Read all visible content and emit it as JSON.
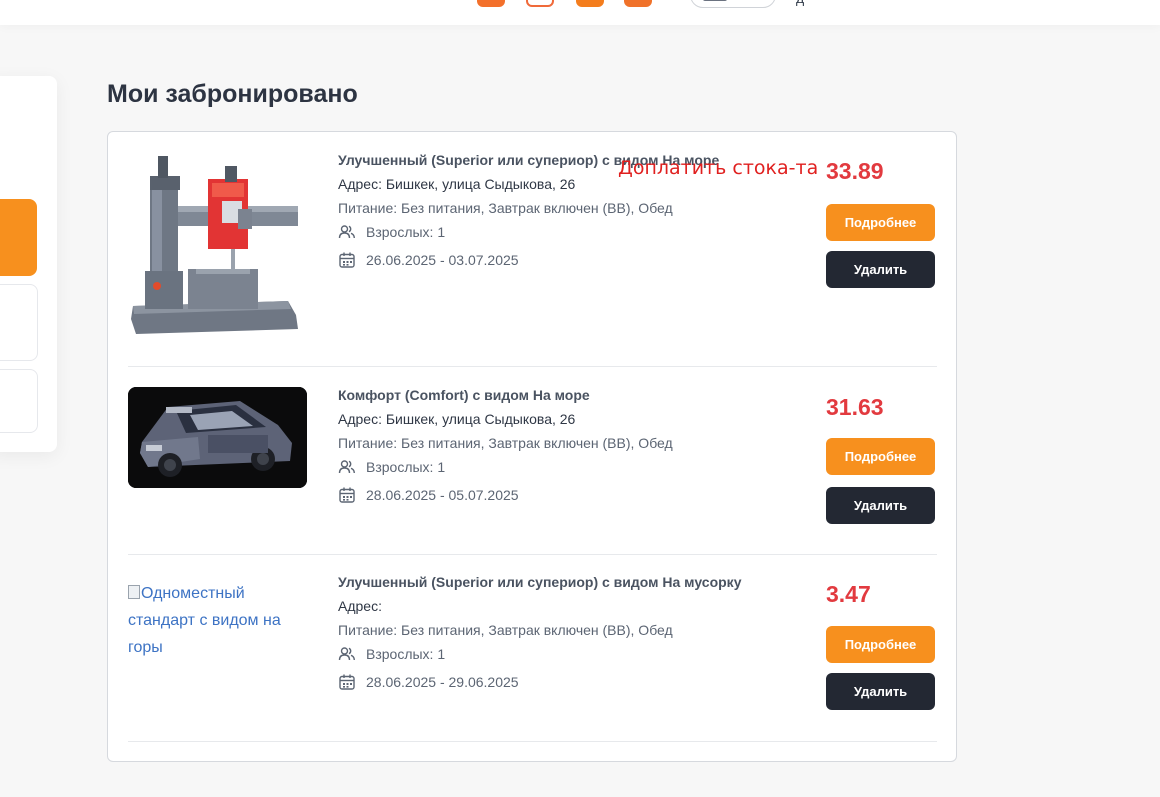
{
  "page_title": "Мои забронировано",
  "notice": "Доплатить стока-та",
  "topbar": {
    "trail_text": "д"
  },
  "colors": {
    "accent": "#f7901e",
    "dark_button": "#232833",
    "price": "#e23a3f",
    "notice": "#e0201f"
  },
  "bookings": [
    {
      "room_name": "Улучшенный (Superior или супериор) с видом На море",
      "address": "Адрес: Бишкек, улица Сыдыкова, 26",
      "meal": "Питание: Без питания, Завтрак включен (BB), Обед",
      "guests": "Взрослых: 1",
      "dates": "26.06.2025 - 03.07.2025",
      "price": "33.89",
      "more_label": "Подробнее",
      "delete_label": "Удалить",
      "image": "radial-drill-machine"
    },
    {
      "room_name": "Комфорт (Comfort) с видом На море",
      "address": "Адрес: Бишкек, улица Сыдыкова, 26",
      "meal": "Питание: Без питания, Завтрак включен (BB), Обед",
      "guests": "Взрослых: 1",
      "dates": "28.06.2025 - 05.07.2025",
      "price": "31.63",
      "more_label": "Подробнее",
      "delete_label": "Удалить",
      "image": "old-hatchback-car"
    },
    {
      "room_name": "Улучшенный (Superior или супериор) с видом На мусорку",
      "address": "Адрес:",
      "meal": "Питание: Без питания, Завтрак включен (BB), Обед",
      "guests": "Взрослых: 1",
      "dates": "28.06.2025 - 29.06.2025",
      "price": "3.47",
      "more_label": "Подробнее",
      "delete_label": "Удалить",
      "image_alt": "Одноместный стандарт с видом на горы"
    }
  ]
}
